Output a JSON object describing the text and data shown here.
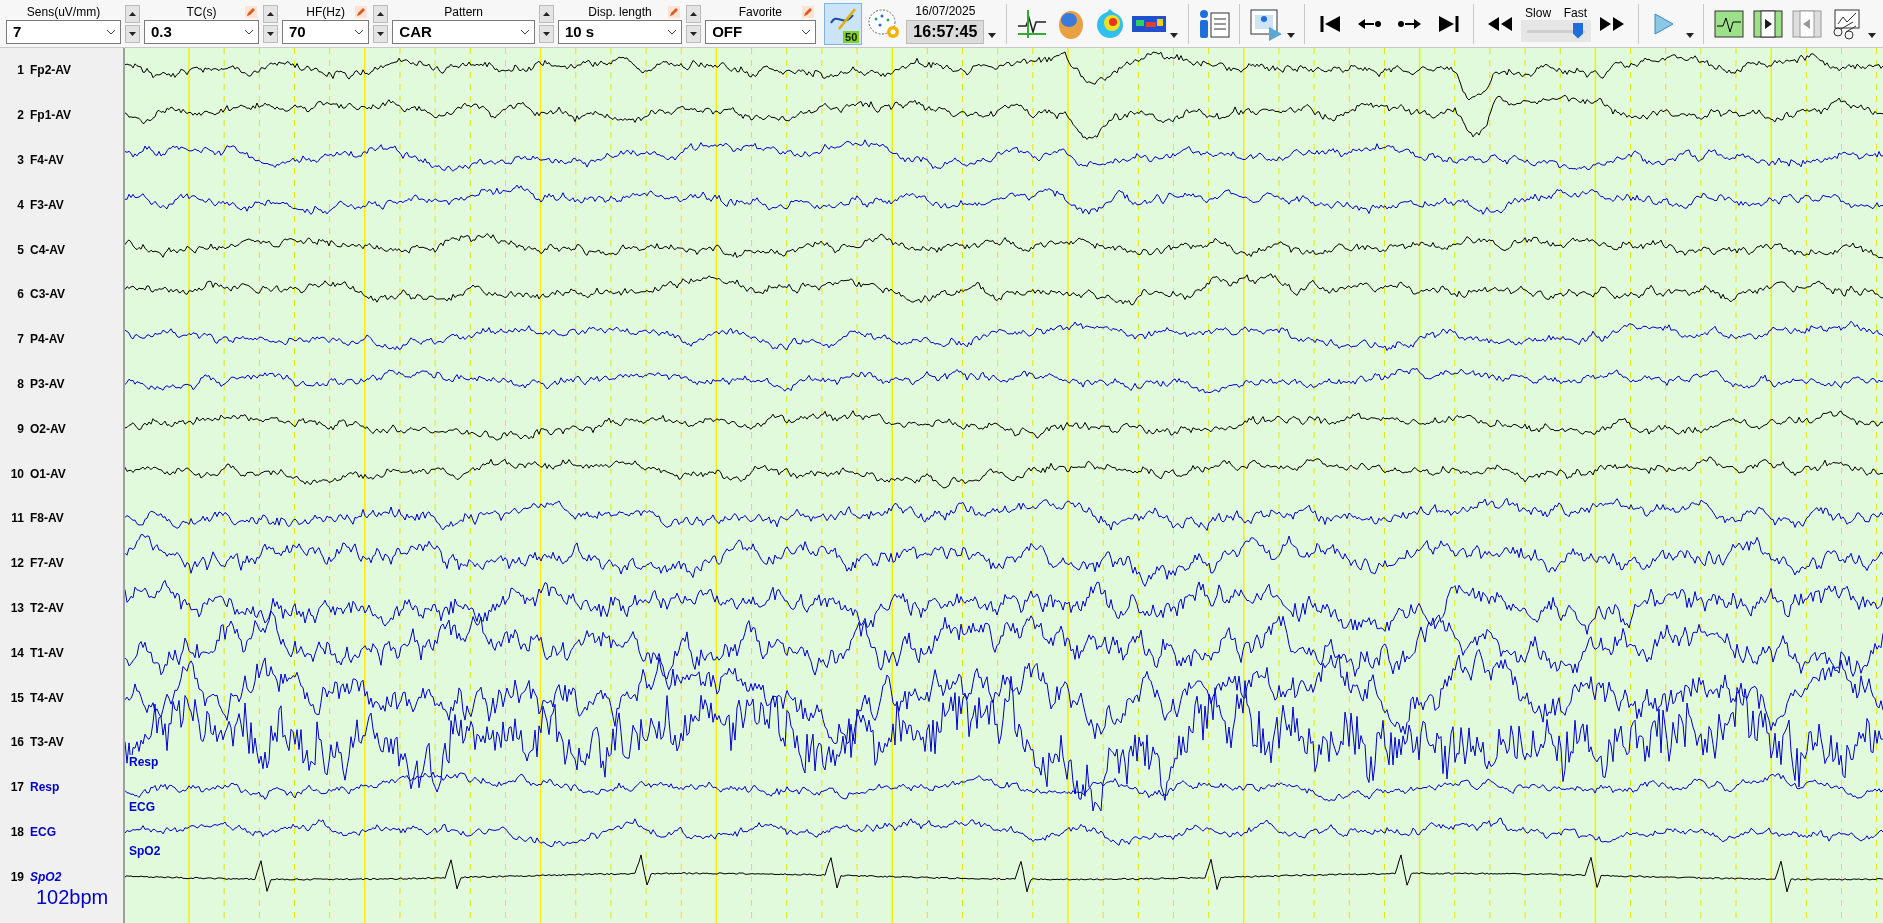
{
  "toolbar": {
    "selectors": [
      {
        "label": "Sens(uV/mm)",
        "value": "7",
        "pencil": false,
        "spin": true
      },
      {
        "label": "TC(s)",
        "value": "0.3",
        "pencil": true,
        "spin": true
      },
      {
        "label": "HF(Hz)",
        "value": "70",
        "pencil": true,
        "spin": true
      },
      {
        "label": "Pattern",
        "value": "CAR",
        "pencil": false,
        "spin": true
      },
      {
        "label": "Disp. length",
        "value": "10 s",
        "pencil": true,
        "spin": true
      },
      {
        "label": "Favorite",
        "value": "OFF",
        "pencil": true,
        "spin": false
      }
    ],
    "filter_button": {
      "badge": "50",
      "selected": true
    },
    "date": "16/07/2025",
    "time": "16:57:45",
    "speed": {
      "slow_label": "Slow",
      "fast_label": "Fast",
      "level": 0.88
    }
  },
  "channels": [
    {
      "number": "1",
      "name": "Fp2-AV",
      "kind": "eeg",
      "color": "#000000"
    },
    {
      "number": "2",
      "name": "Fp1-AV",
      "kind": "eeg",
      "color": "#000000"
    },
    {
      "number": "3",
      "name": "F4-AV",
      "kind": "eeg",
      "color": "#0000c8"
    },
    {
      "number": "4",
      "name": "F3-AV",
      "kind": "eeg",
      "color": "#0000c8"
    },
    {
      "number": "5",
      "name": "C4-AV",
      "kind": "eeg",
      "color": "#000000"
    },
    {
      "number": "6",
      "name": "C3-AV",
      "kind": "eeg",
      "color": "#000000"
    },
    {
      "number": "7",
      "name": "P4-AV",
      "kind": "eeg",
      "color": "#0000c8"
    },
    {
      "number": "8",
      "name": "P3-AV",
      "kind": "eeg",
      "color": "#0000c8"
    },
    {
      "number": "9",
      "name": "O2-AV",
      "kind": "eeg",
      "color": "#000000"
    },
    {
      "number": "10",
      "name": "O1-AV",
      "kind": "eeg",
      "color": "#000000"
    },
    {
      "number": "11",
      "name": "F8-AV",
      "kind": "eeg",
      "color": "#0000c8"
    },
    {
      "number": "12",
      "name": "F7-AV",
      "kind": "eeg",
      "color": "#0000c8"
    },
    {
      "number": "13",
      "name": "T2-AV",
      "kind": "eeg",
      "color": "#0000c8"
    },
    {
      "number": "14",
      "name": "T1-AV",
      "kind": "eeg",
      "color": "#0000c8"
    },
    {
      "number": "15",
      "name": "T4-AV",
      "kind": "eeg",
      "color": "#0000c8"
    },
    {
      "number": "16",
      "name": "T3-AV",
      "kind": "eeg",
      "color": "#0000c8"
    },
    {
      "number": "17",
      "name": "Resp",
      "kind": "aux",
      "color": "#0000c8",
      "trace_label": "Resp"
    },
    {
      "number": "18",
      "name": "ECG",
      "kind": "aux",
      "color": "#0000c8",
      "trace_label": "ECG"
    },
    {
      "number": "19",
      "name": "SpO2",
      "kind": "pulse",
      "color": "#000000",
      "trace_label": "SpO2",
      "reading": "102bpm"
    }
  ]
}
